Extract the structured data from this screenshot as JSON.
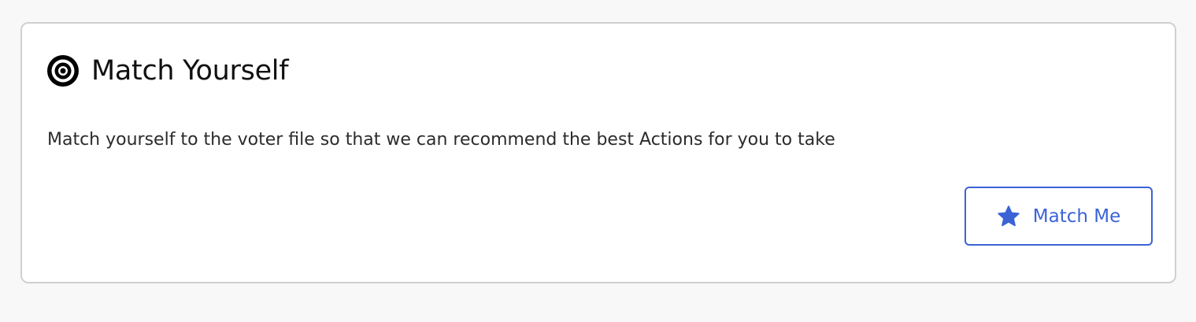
{
  "card": {
    "title": "Match Yourself",
    "icon": "target-icon",
    "description": "Match yourself to the voter file so that we can recommend the best Actions for you to take",
    "button": {
      "label": "Match Me",
      "icon": "star-icon"
    }
  },
  "colors": {
    "accent": "#3b63d6",
    "card_border": "#d0d0d0",
    "page_background": "#f8f8f8"
  }
}
